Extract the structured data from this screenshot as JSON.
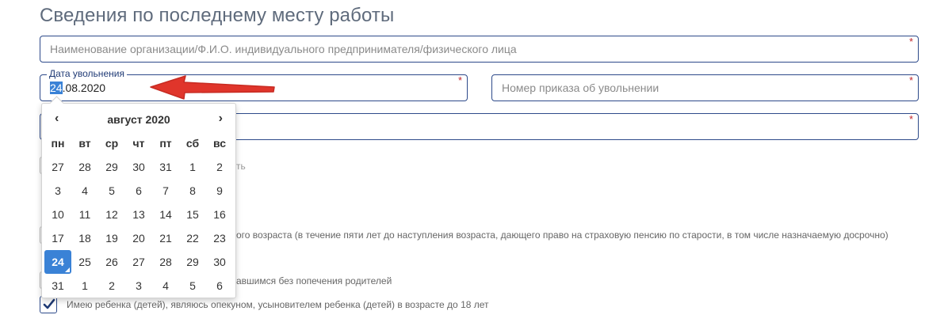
{
  "section_title": "Сведения по последнему месту работы",
  "org_field": {
    "placeholder": "Наименование организации/Ф.И.О. индивидуального предпринимателя/физического лица",
    "required_mark": "*"
  },
  "dismissal_date": {
    "legend": "Дата увольнения",
    "value_selected": "24",
    "value_rest": ".08.2020",
    "required_mark": "*"
  },
  "order_field": {
    "placeholder": "Номер приказа об увольнении",
    "required_mark": "*"
  },
  "third_field": {
    "required_mark": "*"
  },
  "calendar": {
    "prev": "‹",
    "next": "›",
    "month_label": "август 2020",
    "weekdays": [
      "пн",
      "вт",
      "ср",
      "чт",
      "пт",
      "сб",
      "вс"
    ],
    "weeks": [
      [
        "27",
        "28",
        "29",
        "30",
        "31",
        "1",
        "2"
      ],
      [
        "3",
        "4",
        "5",
        "6",
        "7",
        "8",
        "9"
      ],
      [
        "10",
        "11",
        "12",
        "13",
        "14",
        "15",
        "16"
      ],
      [
        "17",
        "18",
        "19",
        "20",
        "21",
        "22",
        "23"
      ],
      [
        "24",
        "25",
        "26",
        "27",
        "28",
        "29",
        "30"
      ],
      [
        "31",
        "1",
        "2",
        "3",
        "4",
        "5",
        "6"
      ]
    ],
    "selected_day": "24"
  },
  "background_texts": {
    "t1": "ть",
    "t2": "ого возраста (в течение пяти лет до наступления возраста, дающего право на страховую пенсию по старости, в том числе назначаемую досрочно)",
    "t3": "авшимся без попечения родителей",
    "t4": "Имею ребенка (детей), являюсь опекуном, усыновителем ребенка (детей) в возрасте до 18 лет"
  },
  "colors": {
    "accent": "#3a82d6",
    "border": "#2d4a8a",
    "required": "#c0272d",
    "arrow": "#e0352b"
  }
}
